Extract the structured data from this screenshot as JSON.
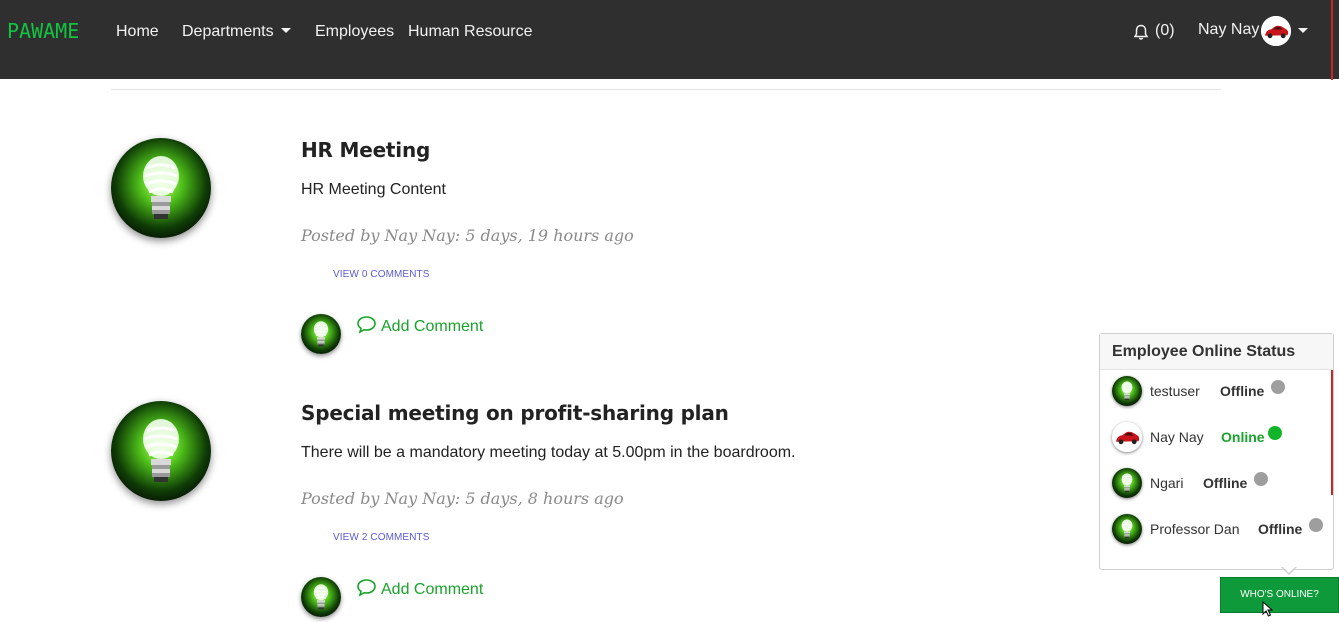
{
  "navbar": {
    "brand": "PAWAME",
    "links": [
      "Home",
      "Departments",
      "Employees",
      "Human Resource"
    ],
    "notifications": "(0)",
    "user": "Nay Nay",
    "bg_color": "#2f2f2f",
    "brand_color": "#12c43f"
  },
  "posts": [
    {
      "title": "HR Meeting",
      "content": "HR Meeting Content",
      "meta": "Posted by Nay Nay: 5 days, 19 hours ago",
      "view_comments": "VIEW 0 COMMENTS",
      "add_comment": "Add Comment"
    },
    {
      "title": "Special meeting on profit-sharing plan",
      "content": "There will be a mandatory meeting today at 5.00pm in the boardroom.",
      "meta": "Posted by Nay Nay: 5 days, 8 hours ago",
      "view_comments": "VIEW 2 COMMENTS",
      "add_comment": "Add Comment"
    }
  ],
  "online_panel": {
    "title": "Employee Online Status",
    "employees": [
      {
        "name": "testuser",
        "status": "Offline",
        "avatar": "bulb-icon"
      },
      {
        "name": "Nay Nay",
        "status": "Online",
        "avatar": "car-icon"
      },
      {
        "name": "Ngari",
        "status": "Offline",
        "avatar": "bulb-icon"
      },
      {
        "name": "Professor Dan",
        "status": "Offline",
        "avatar": "bulb-icon"
      }
    ],
    "online_color": "#1aa32c",
    "offline_color": "#9e9e9e"
  },
  "whos_online_button": "WHO'S ONLINE?"
}
